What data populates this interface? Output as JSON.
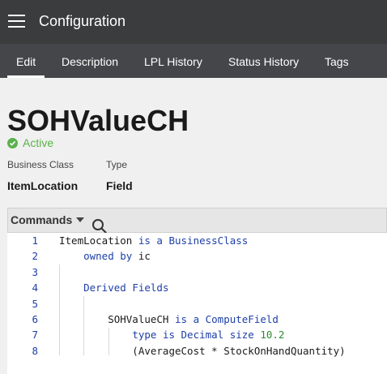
{
  "header": {
    "title": "Configuration",
    "menu_icon": "hamburger-menu-icon"
  },
  "tabs": [
    {
      "label": "Edit",
      "active": true
    },
    {
      "label": "Description"
    },
    {
      "label": "LPL History"
    },
    {
      "label": "Status History"
    },
    {
      "label": "Tags"
    }
  ],
  "record": {
    "title": "SOHValueCH",
    "status": "Active",
    "business_class_label": "Business Class",
    "business_class_value": "ItemLocation",
    "type_label": "Type",
    "type_value": "Field"
  },
  "commands": {
    "label": "Commands",
    "search_icon": "search-icon"
  },
  "editor": {
    "line_numbers": [
      "1",
      "2",
      "3",
      "4",
      "5",
      "6",
      "7",
      "8"
    ],
    "lines": [
      [
        {
          "t": "ItemLocation "
        },
        {
          "t": "is a BusinessClass",
          "k": "kw"
        }
      ],
      [
        {
          "t": "    "
        },
        {
          "t": "owned by",
          "k": "kw"
        },
        {
          "t": " ic"
        }
      ],
      [
        {
          "t": ""
        }
      ],
      [
        {
          "t": "    "
        },
        {
          "t": "Derived Fields",
          "k": "kw"
        }
      ],
      [
        {
          "t": ""
        }
      ],
      [
        {
          "t": "        SOHValueCH "
        },
        {
          "t": "is a ComputeField",
          "k": "kw"
        }
      ],
      [
        {
          "t": "            "
        },
        {
          "t": "type is Decimal size",
          "k": "kw"
        },
        {
          "t": " "
        },
        {
          "t": "10.2",
          "k": "num"
        }
      ],
      [
        {
          "t": "            (AverageCost * StockOnHandQuantity)"
        }
      ]
    ]
  },
  "colors": {
    "appbar": "#3b3c3e",
    "tabbar": "#454649",
    "active_green": "#5ab24a",
    "keyword_blue": "#1e3fa8",
    "number_green": "#2e8b2e"
  }
}
